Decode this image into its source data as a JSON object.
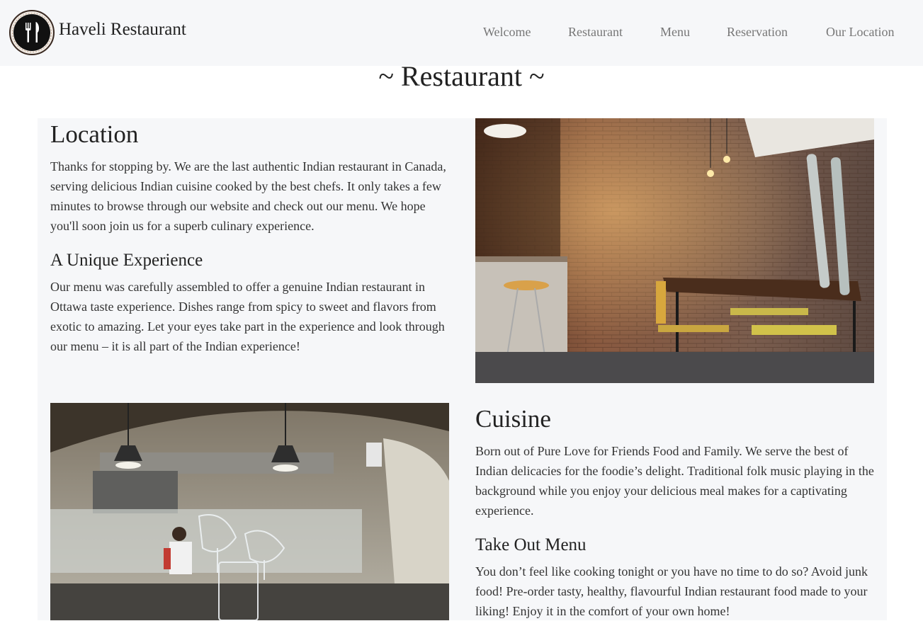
{
  "header": {
    "brand_name": "Haveli Restaurant",
    "nav_items": [
      {
        "label": "Welcome"
      },
      {
        "label": "Restaurant"
      },
      {
        "label": "Menu"
      },
      {
        "label": "Reservation"
      },
      {
        "label": "Our Location"
      }
    ]
  },
  "page": {
    "title": "~ Restaurant ~"
  },
  "sections": {
    "location": {
      "heading": "Location",
      "text": "Thanks for stopping by. We are the last authentic Indian restaurant in Canada, serving delicious Indian cuisine cooked by the best chefs. It only takes a few minutes to browse through our website and check out our menu. We hope you'll soon join us for a superb culinary experience."
    },
    "unique": {
      "heading": "A Unique Experience",
      "text": "Our menu was carefully assembled to offer a genuine Indian restaurant in Ottawa taste experience. Dishes range from spicy to sweet and flavors from exotic to amazing. Let your eyes take part in the experience and look through our menu – it is all part of the Indian experience!"
    },
    "cuisine": {
      "heading": "Cuisine",
      "text": "Born out of Pure Love for Friends Food and Family. We serve the best of Indian delicacies for the foodie’s delight. Traditional folk music playing in the background while you enjoy your delicious meal makes for a captivating experience."
    },
    "takeout": {
      "heading": "Take Out Menu",
      "text": "You don’t feel like cooking tonight or you have no time to do so? Avoid junk food! Pre-order tasty, healthy, flavourful Indian restaurant food made to your liking! Enjoy it in the comfort of your own home!"
    }
  },
  "colors": {
    "navbar_bg": "#f6f7f9",
    "nav_link": "#777777",
    "text": "#222222"
  }
}
